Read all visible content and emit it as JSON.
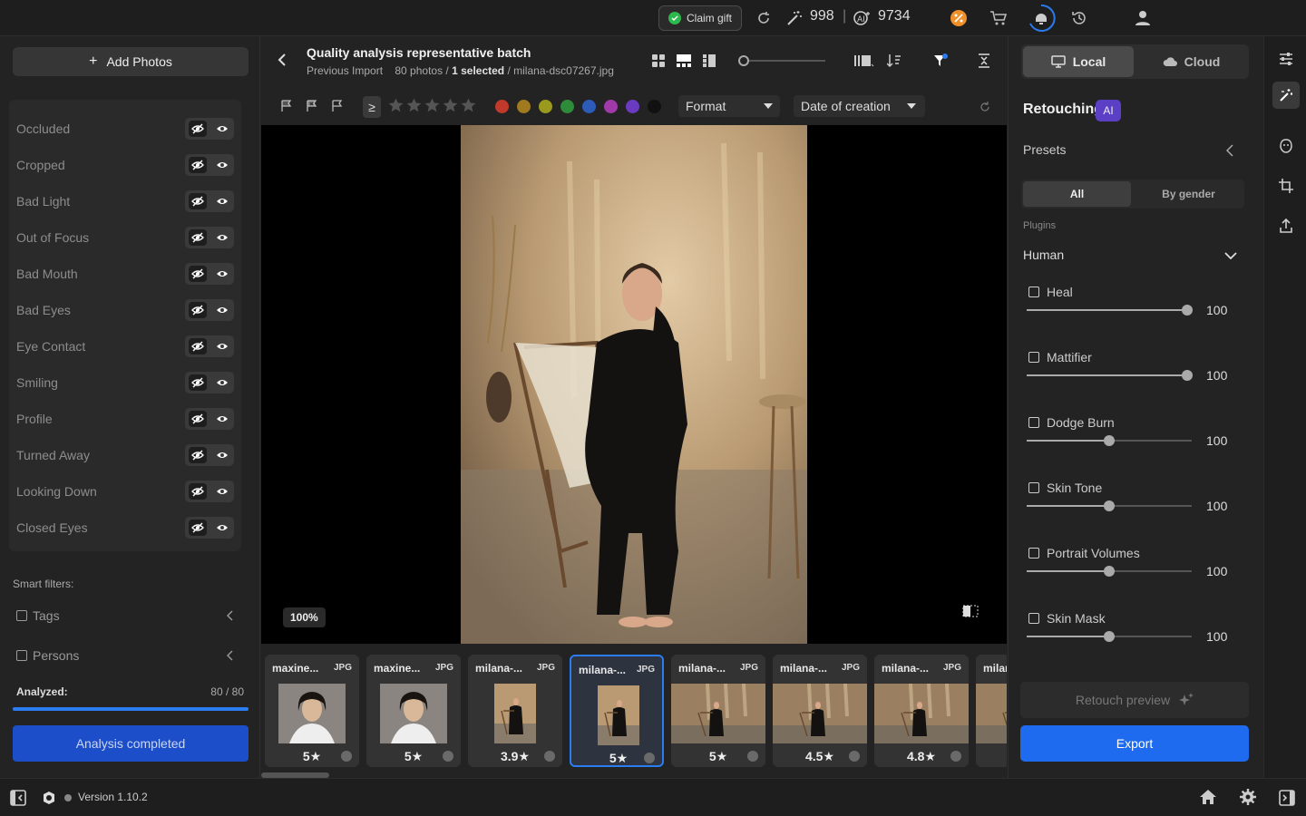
{
  "topbar": {
    "claim_gift": "Claim gift",
    "credits": "998",
    "separator": "|",
    "ai_credits": "9734"
  },
  "left": {
    "add_photos": "Add Photos",
    "filters": [
      {
        "label": "Occluded"
      },
      {
        "label": "Cropped"
      },
      {
        "label": "Bad Light"
      },
      {
        "label": "Out of Focus"
      },
      {
        "label": "Bad Mouth"
      },
      {
        "label": "Bad Eyes"
      },
      {
        "label": "Eye Contact"
      },
      {
        "label": "Smiling"
      },
      {
        "label": "Profile"
      },
      {
        "label": "Turned Away"
      },
      {
        "label": "Looking Down"
      },
      {
        "label": "Closed Eyes"
      }
    ],
    "smart_filters": "Smart filters:",
    "tags": "Tags",
    "persons": "Persons",
    "analyzed_label": "Analyzed:",
    "analyzed_count": "80 / 80",
    "analyzed_fraction": 1.0,
    "analysis_button": "Analysis completed"
  },
  "center": {
    "title": "Quality analysis representative batch",
    "sub_prev": "Previous Import",
    "sub_photos": "80 photos / ",
    "sub_selected": "1 selected",
    "sub_file": " / milana-dsc07267.jpg",
    "ge_symbol": "≥",
    "format_dd": "Format",
    "date_dd": "Date of creation",
    "zoom": "100%",
    "color_labels": [
      "#c0392b",
      "#a07a1f",
      "#9a9a1f",
      "#2e8b3a",
      "#2d5bb8",
      "#a03aa8",
      "#6a3ac0",
      "#111111"
    ],
    "thumbnails": [
      {
        "name": "maxine...",
        "type": "JPG",
        "rating": "5★",
        "kind": "portrait-light"
      },
      {
        "name": "maxine...",
        "type": "JPG",
        "rating": "5★",
        "kind": "portrait-light"
      },
      {
        "name": "milana-...",
        "type": "JPG",
        "rating": "3.9★",
        "kind": "portrait-warm"
      },
      {
        "name": "milana-...",
        "type": "JPG",
        "rating": "5★",
        "kind": "portrait-warm",
        "selected": true
      },
      {
        "name": "milana-...",
        "type": "JPG",
        "rating": "5★",
        "kind": "landscape-warm"
      },
      {
        "name": "milana-...",
        "type": "JPG",
        "rating": "4.5★",
        "kind": "landscape-warm"
      },
      {
        "name": "milana-...",
        "type": "JPG",
        "rating": "4.8★",
        "kind": "landscape-warm"
      },
      {
        "name": "milan",
        "type": "",
        "rating": "",
        "kind": "landscape-warm"
      }
    ]
  },
  "right": {
    "local": "Local",
    "cloud": "Cloud",
    "retouching": "Retouching",
    "ai": "AI",
    "presets": "Presets",
    "seg_all": "All",
    "seg_gender": "By gender",
    "plugins": "Plugins",
    "human": "Human",
    "sliders": [
      {
        "name": "Heal",
        "value": "100",
        "level": 0.97
      },
      {
        "name": "Mattifier",
        "value": "100",
        "level": 0.97
      },
      {
        "name": "Dodge Burn",
        "value": "100",
        "level": 0.5
      },
      {
        "name": "Skin Tone",
        "value": "100",
        "level": 0.5
      },
      {
        "name": "Portrait Volumes",
        "value": "100",
        "level": 0.5
      },
      {
        "name": "Skin Mask",
        "value": "100",
        "level": 0.5
      }
    ],
    "retouch_preview": "Retouch preview",
    "export": "Export"
  },
  "footer": {
    "version": "Version 1.10.2"
  }
}
